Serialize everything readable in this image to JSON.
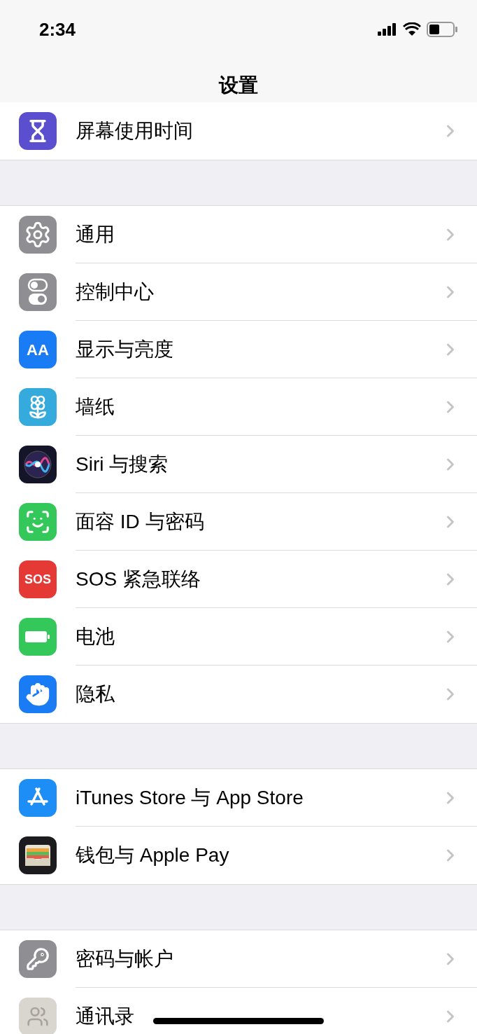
{
  "status_bar": {
    "time": "2:34"
  },
  "nav": {
    "title": "设置"
  },
  "groups": [
    {
      "items": [
        {
          "kind": "hourglass",
          "label": "屏幕使用时间"
        }
      ]
    },
    {
      "items": [
        {
          "kind": "gear",
          "label": "通用"
        },
        {
          "kind": "toggles",
          "label": "控制中心"
        },
        {
          "kind": "text_size",
          "icon_text": "AA",
          "label": "显示与亮度"
        },
        {
          "kind": "flower",
          "label": "墙纸"
        },
        {
          "kind": "siri",
          "label": "Siri 与搜索"
        },
        {
          "kind": "face",
          "label": "面容 ID 与密码"
        },
        {
          "kind": "sos",
          "icon_text": "SOS",
          "label": "SOS 紧急联络"
        },
        {
          "kind": "battery",
          "label": "电池"
        },
        {
          "kind": "hand",
          "label": "隐私"
        }
      ]
    },
    {
      "items": [
        {
          "kind": "appstore",
          "label": "iTunes Store 与 App Store"
        },
        {
          "kind": "wallet",
          "label": "钱包与 Apple Pay"
        }
      ]
    },
    {
      "items": [
        {
          "kind": "key",
          "label": "密码与帐户"
        },
        {
          "kind": "contacts",
          "label": "通讯录"
        }
      ]
    }
  ]
}
